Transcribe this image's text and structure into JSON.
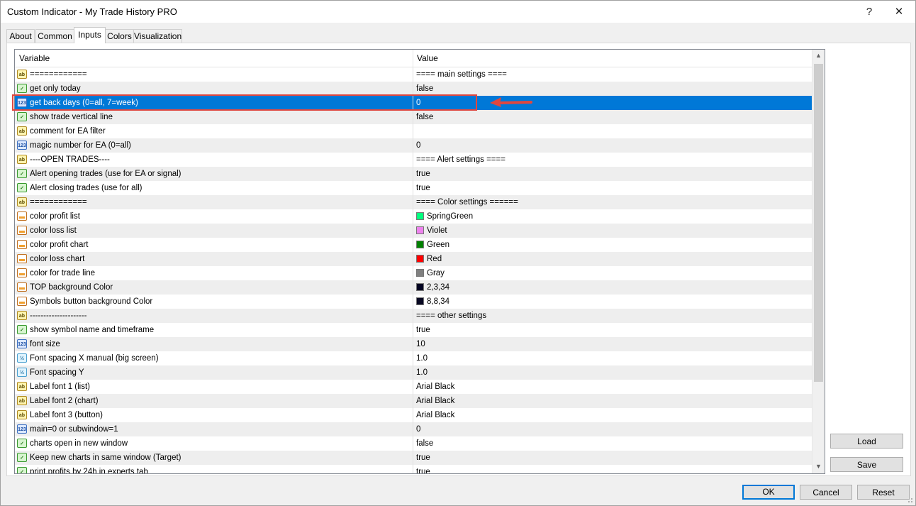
{
  "window": {
    "title": "Custom Indicator - My Trade History PRO",
    "help_label": "?",
    "close_label": "✕"
  },
  "tabs": [
    {
      "label": "About"
    },
    {
      "label": "Common"
    },
    {
      "label": "Inputs",
      "active": true
    },
    {
      "label": "Colors"
    },
    {
      "label": "Visualization"
    }
  ],
  "grid": {
    "headers": {
      "variable": "Variable",
      "value": "Value"
    },
    "selected_row": 2,
    "rows": [
      {
        "icon": "string-icon",
        "type": "str",
        "variable": "============",
        "value": "==== main settings ===="
      },
      {
        "icon": "bool-icon",
        "type": "bool",
        "variable": "get only today",
        "value": "false"
      },
      {
        "icon": "int-icon",
        "type": "int",
        "variable": "get back days (0=all, 7=week)",
        "value": "0"
      },
      {
        "icon": "bool-icon",
        "type": "bool",
        "variable": "show trade vertical line",
        "value": "false"
      },
      {
        "icon": "string-icon",
        "type": "str",
        "variable": "comment for EA filter",
        "value": ""
      },
      {
        "icon": "int-icon",
        "type": "int",
        "variable": "magic number for EA (0=all)",
        "value": "0"
      },
      {
        "icon": "string-icon",
        "type": "str",
        "variable": "----OPEN TRADES----",
        "value": "==== Alert settings ===="
      },
      {
        "icon": "bool-icon",
        "type": "bool",
        "variable": "Alert opening trades (use for EA or signal)",
        "value": "true"
      },
      {
        "icon": "bool-icon",
        "type": "bool",
        "variable": "Alert closing trades (use for all)",
        "value": "true"
      },
      {
        "icon": "string-icon",
        "type": "str",
        "variable": "============",
        "value": "==== Color settings ======"
      },
      {
        "icon": "color-icon",
        "type": "clr",
        "variable": "color profit list",
        "value": "SpringGreen",
        "color": "#00ff7f"
      },
      {
        "icon": "color-icon",
        "type": "clr",
        "variable": "color loss list",
        "value": "Violet",
        "color": "#ee82ee"
      },
      {
        "icon": "color-icon",
        "type": "clr",
        "variable": "color profit chart",
        "value": "Green",
        "color": "#008000"
      },
      {
        "icon": "color-icon",
        "type": "clr",
        "variable": "color loss chart",
        "value": "Red",
        "color": "#ff0000"
      },
      {
        "icon": "color-icon",
        "type": "clr",
        "variable": "color for trade line",
        "value": "Gray",
        "color": "#808080"
      },
      {
        "icon": "color-icon",
        "type": "clr",
        "variable": "TOP background Color",
        "value": "2,3,34",
        "color": "#020322"
      },
      {
        "icon": "color-icon",
        "type": "clr",
        "variable": "Symbols button background Color",
        "value": "8,8,34",
        "color": "#080822"
      },
      {
        "icon": "string-icon",
        "type": "str",
        "variable": "---------------------",
        "value": "==== other settings"
      },
      {
        "icon": "bool-icon",
        "type": "bool",
        "variable": "show symbol name and timeframe",
        "value": "true"
      },
      {
        "icon": "int-icon",
        "type": "int",
        "variable": "font size",
        "value": "10"
      },
      {
        "icon": "double-icon",
        "type": "dbl",
        "variable": "Font spacing X manual (big screen)",
        "value": "1.0"
      },
      {
        "icon": "double-icon",
        "type": "dbl",
        "variable": "Font spacing Y",
        "value": "1.0"
      },
      {
        "icon": "string-icon",
        "type": "str",
        "variable": "Label font 1 (list)",
        "value": "Arial Black"
      },
      {
        "icon": "string-icon",
        "type": "str",
        "variable": "Label font 2 (chart)",
        "value": "Arial Black"
      },
      {
        "icon": "string-icon",
        "type": "str",
        "variable": "Label font 3 (button)",
        "value": "Arial Black"
      },
      {
        "icon": "int-icon",
        "type": "int",
        "variable": "main=0 or subwindow=1",
        "value": "0"
      },
      {
        "icon": "bool-icon",
        "type": "bool",
        "variable": "charts open in new window",
        "value": "false"
      },
      {
        "icon": "bool-icon",
        "type": "bool",
        "variable": "Keep new charts in same window (Target)",
        "value": "true"
      },
      {
        "icon": "bool-icon",
        "type": "bool",
        "variable": "print profits by 24h in experts tab",
        "value": "true"
      }
    ]
  },
  "icon_glyphs": {
    "str": "ab",
    "bool": "✓",
    "int": "123",
    "dbl": "½",
    "clr": ""
  },
  "side_buttons": {
    "load": "Load",
    "save": "Save"
  },
  "footer_buttons": {
    "ok": "OK",
    "cancel": "Cancel",
    "reset": "Reset"
  },
  "colors": {
    "selection": "#0078d7",
    "highlight_box": "#e0473e"
  }
}
